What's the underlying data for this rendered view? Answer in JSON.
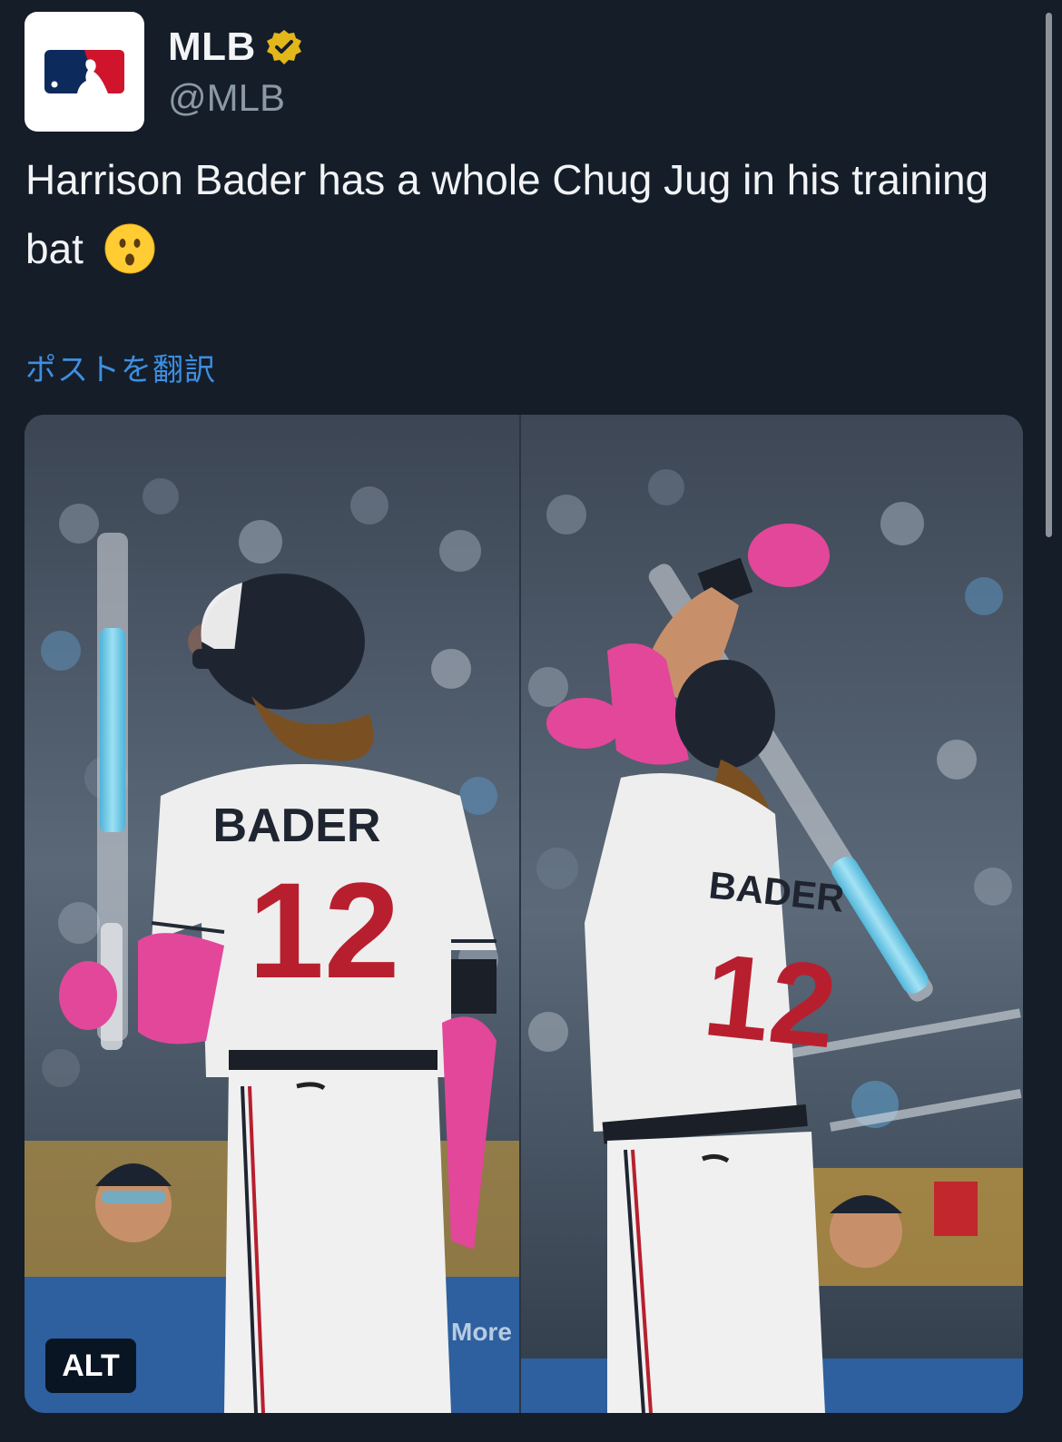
{
  "author": {
    "display_name": "MLB",
    "handle": "@MLB",
    "avatar_icon": "mlb-logo-icon",
    "verified": true,
    "verified_color": "#e2b719"
  },
  "tweet": {
    "text": "Harrison Bader has a whole Chug Jug in his training bat",
    "emoji": "face-with-open-mouth-emoji",
    "translate_label": "ポストを翻訳"
  },
  "media": {
    "photo_left": {
      "jersey_name": "BADER",
      "jersey_number": "12"
    },
    "photo_right": {
      "jersey_name": "BADER",
      "jersey_number": "12"
    },
    "alt_label": "ALT"
  },
  "colors": {
    "background": "#151d29",
    "link": "#3d8fe0",
    "accent_pink": "#e2479a",
    "bat_liquid": "#6cc7e8"
  }
}
